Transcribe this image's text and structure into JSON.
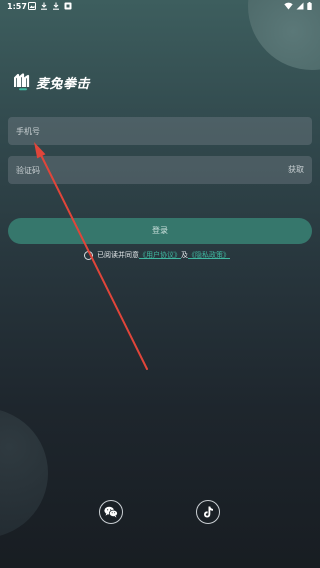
{
  "status_bar": {
    "time": "1:57"
  },
  "brand": {
    "name": "麦兔拳击"
  },
  "login_form": {
    "phone_placeholder": "手机号",
    "code_placeholder": "验证码",
    "get_code_label": "获取",
    "login_label": "登录"
  },
  "agreement": {
    "prefix": "已阅读并同意",
    "user_agreement": "《用户协议》",
    "conjunction": "及",
    "privacy_policy": "《隐私政策》"
  },
  "social_login": {
    "wechat_icon": "wechat-icon",
    "tiktok_icon": "tiktok-icon"
  },
  "colors": {
    "accent": "#36776c",
    "link": "#3fb8a0",
    "annotation_arrow": "#e0453a"
  }
}
